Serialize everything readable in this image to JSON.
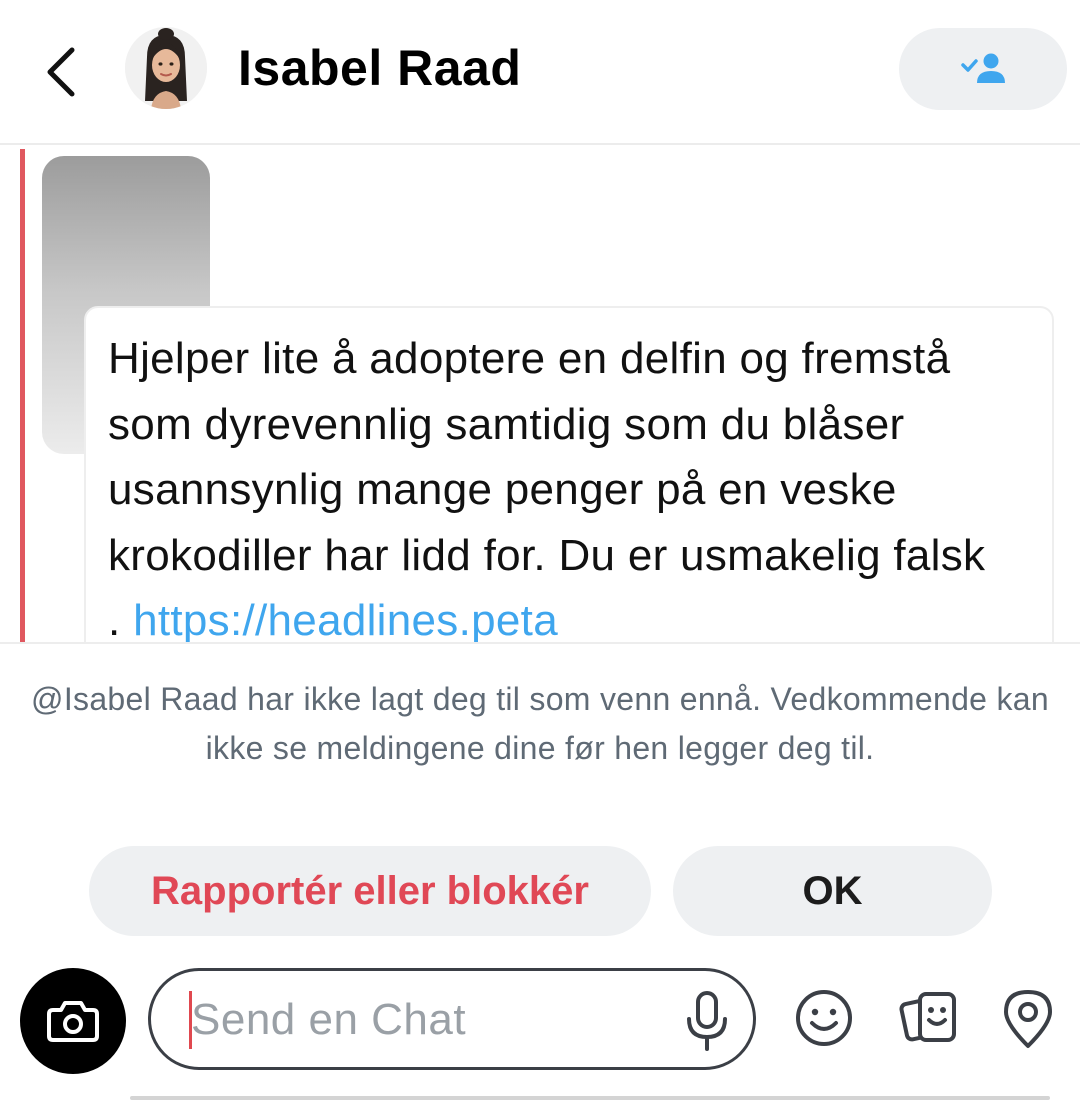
{
  "header": {
    "back_icon": "chevron-left-icon",
    "avatar_icon": "bitmoji-avatar",
    "contact_name": "Isabel Raad",
    "friend_button_icon": "add-friend-check-icon",
    "accent_color": "#3fa6ee"
  },
  "chat": {
    "indicator_color": "#e0585f",
    "message": {
      "text": "Hjelper lite å adoptere en delfin og fremstå som dyrevennlig samtidig som du blåser usannsynlig mange penger på en veske krokodiller har lidd for. Du er usmakelig falsk . ",
      "link": "https://headlines.peta"
    }
  },
  "notice": {
    "text": "@Isabel Raad har ikke lagt deg til som venn ennå. Vedkommende kan ikke se meldingene dine før hen legger deg til.",
    "report_label": "Rapportér eller blokkér",
    "ok_label": "OK",
    "report_color": "#e04856"
  },
  "composer": {
    "placeholder": "Send en Chat",
    "value": "",
    "icons": [
      "camera-icon",
      "microphone-icon",
      "emoji-icon",
      "stickers-icon",
      "location-pin-icon"
    ]
  }
}
